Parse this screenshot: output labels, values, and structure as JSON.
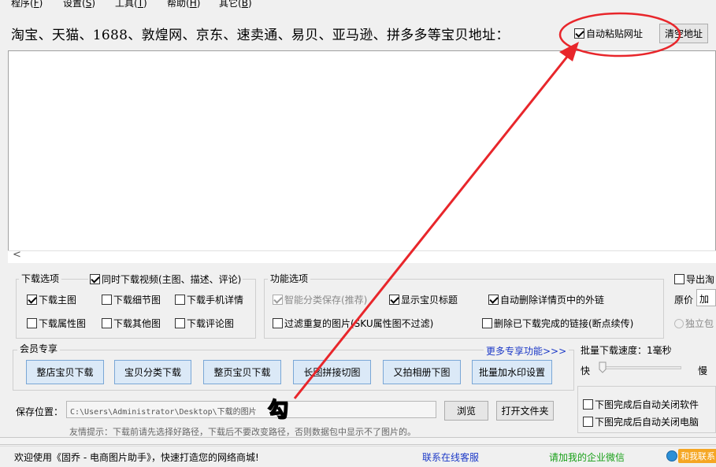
{
  "menu": [
    {
      "label": "程序",
      "key": "F"
    },
    {
      "label": "设置",
      "key": "S"
    },
    {
      "label": "工具",
      "key": "T"
    },
    {
      "label": "帮助",
      "key": "H"
    },
    {
      "label": "其它",
      "key": "B"
    }
  ],
  "url_bar": {
    "platforms_text": "淘宝、天猫、1688、敦煌网、京东、速卖通、易贝、亚马逊、拼多多等宝贝地址：",
    "auto_paste_label": "自动粘贴网址",
    "auto_paste_checked": true,
    "clear_button": "清空地址",
    "scroll_left_glyph": "<"
  },
  "download_options": {
    "title": "下载选项",
    "video_option": "同时下载视频(主图、描述、评论)",
    "items": [
      {
        "label": "下载主图",
        "checked": true
      },
      {
        "label": "下载细节图",
        "checked": false
      },
      {
        "label": "下载手机详情",
        "checked": false
      },
      {
        "label": "下载属性图",
        "checked": false
      },
      {
        "label": "下载其他图",
        "checked": false
      },
      {
        "label": "下载评论图",
        "checked": false
      }
    ]
  },
  "function_options": {
    "title": "功能选项",
    "items": [
      {
        "label": "智能分类保存(推荐)",
        "checked": true,
        "disabled": true
      },
      {
        "label": "显示宝贝标题",
        "checked": true
      },
      {
        "label": "自动删除详情页中的外链",
        "checked": true
      },
      {
        "label": "过滤重复的图片(SKU属性图不过滤)",
        "checked": false
      },
      {
        "label": "删除已下载完成的链接(断点续传)",
        "checked": false
      }
    ]
  },
  "export": {
    "export_label": "导出淘",
    "price_label": "原价",
    "price_value": "加",
    "standalone_label": "独立包"
  },
  "member": {
    "title": "会员专享",
    "more_link": "更多专享功能>>>",
    "buttons": [
      "整店宝贝下载",
      "宝贝分类下载",
      "整页宝贝下载",
      "长图拼接切图",
      "又拍相册下图",
      "批量加水印设置"
    ]
  },
  "speed": {
    "title": "批量下载速度：1毫秒",
    "fast": "快",
    "slow": "慢",
    "value_fraction": 0.0
  },
  "after_download": {
    "close_software": "下图完成后自动关闭软件",
    "shutdown_pc": "下图完成后自动关闭电脑"
  },
  "save": {
    "label": "保存位置：",
    "path": "C:\\Users\\Administrator\\Desktop\\下载的图片",
    "browse_button": "浏览",
    "open_folder_button": "打开文件夹",
    "tip": "友情提示：下载前请先选择好路径，下载后不要改变路径，否则数据包中显示不了图片的。"
  },
  "status": {
    "welcome": "欢迎使用《固乔 - 电商图片助手》，快速打造您的网络商城!",
    "online_service": "联系在线客服",
    "wechat": "请加我的企业微信",
    "contact": "和我联系"
  },
  "annotation": {
    "label": "勾",
    "color": "#e8262b"
  }
}
